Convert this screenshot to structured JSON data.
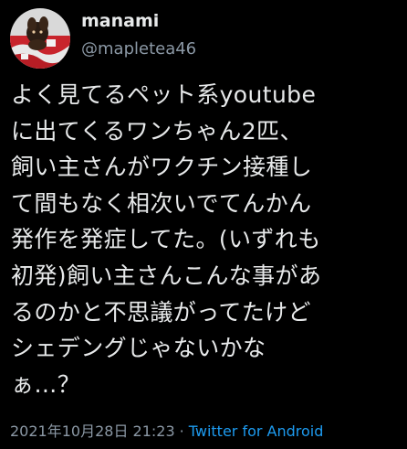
{
  "tweet": {
    "display_name": "manami",
    "handle": "@mapletea46",
    "avatar_icon": "profile-photo-avatar",
    "body_lines": [
      "よく見てるペット系youtube",
      "に出てくるワンちゃん2匹、",
      "飼い主さんがワクチン接種し",
      "て間もなく相次いでてんかん",
      "発作を発症してた。(いずれも",
      "初発)飼い主さんこんな事があ",
      "るのかと不思議がってたけど",
      "シェデングじゃないかな",
      "ぁ…？"
    ],
    "timestamp": "2021年10月28日 21:23",
    "separator": "·",
    "source": "Twitter for Android"
  },
  "colors": {
    "background": "#000000",
    "text_primary": "#e7e9ea",
    "text_secondary": "#8b98a5",
    "link": "#1d9bf0"
  }
}
